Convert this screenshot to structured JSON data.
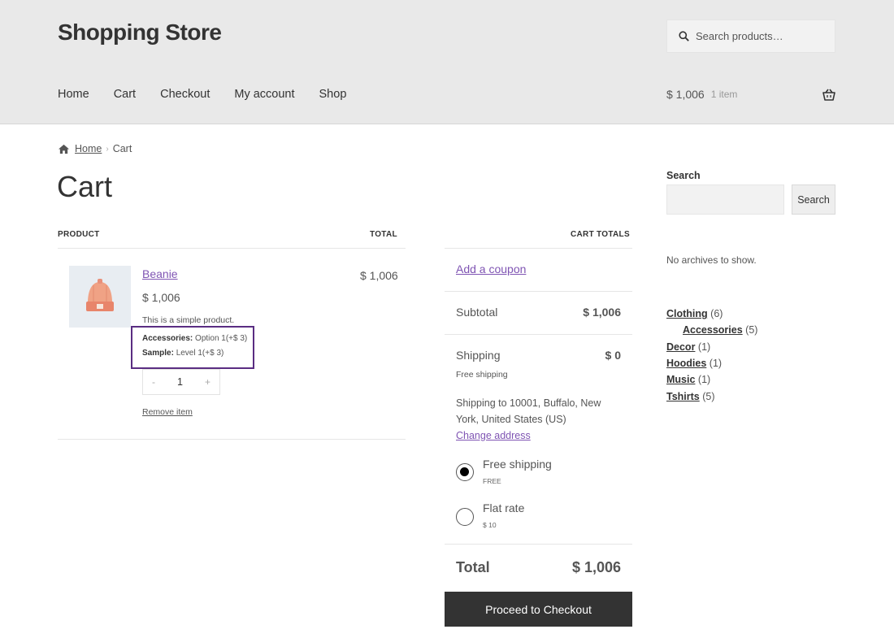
{
  "header": {
    "site_title": "Shopping Store",
    "search_placeholder": "Search products…",
    "nav": [
      "Home",
      "Cart",
      "Checkout",
      "My account",
      "Shop"
    ],
    "mini_cart_amount": "$ 1,006",
    "mini_cart_count": "1 item"
  },
  "breadcrumb": {
    "home": "Home",
    "current": "Cart"
  },
  "page_title": "Cart",
  "cart_table": {
    "col_product": "PRODUCT",
    "col_total": "TOTAL",
    "item": {
      "name": "Beanie",
      "price": "$ 1,006",
      "description": "This is a simple product.",
      "meta": [
        {
          "label": "Accessories:",
          "value": "Option 1(+$ 3)"
        },
        {
          "label": "Sample:",
          "value": "Level 1(+$ 3)"
        }
      ],
      "qty_minus": "-",
      "qty_value": "1",
      "qty_plus": "+",
      "remove": "Remove item",
      "line_total": "$ 1,006"
    }
  },
  "totals": {
    "heading": "CART TOTALS",
    "coupon": "Add a coupon",
    "subtotal_label": "Subtotal",
    "subtotal_value": "$ 1,006",
    "shipping_label": "Shipping",
    "shipping_value": "$ 0",
    "shipping_method": "Free shipping",
    "shipping_dest": "Shipping to 10001, Buffalo, New York, United States (US)",
    "change_address": "Change address",
    "options": [
      {
        "name": "Free shipping",
        "price": "FREE",
        "selected": true
      },
      {
        "name": "Flat rate",
        "price": "$ 10",
        "selected": false
      }
    ],
    "total_label": "Total",
    "total_value": "$ 1,006",
    "checkout_button": "Proceed to Checkout"
  },
  "sidebar": {
    "search_label": "Search",
    "search_button": "Search",
    "no_archives": "No archives to show.",
    "categories": [
      {
        "name": "Clothing",
        "count": "(6)"
      },
      {
        "name": "Accessories",
        "count": "(5)"
      },
      {
        "name": "Decor",
        "count": "(1)"
      },
      {
        "name": "Hoodies",
        "count": "(1)"
      },
      {
        "name": "Music",
        "count": "(1)"
      },
      {
        "name": "Tshirts",
        "count": "(5)"
      }
    ]
  },
  "colors": {
    "accent": "#7f54b3",
    "highlight_box": "#5a2d82",
    "button": "#333333"
  }
}
